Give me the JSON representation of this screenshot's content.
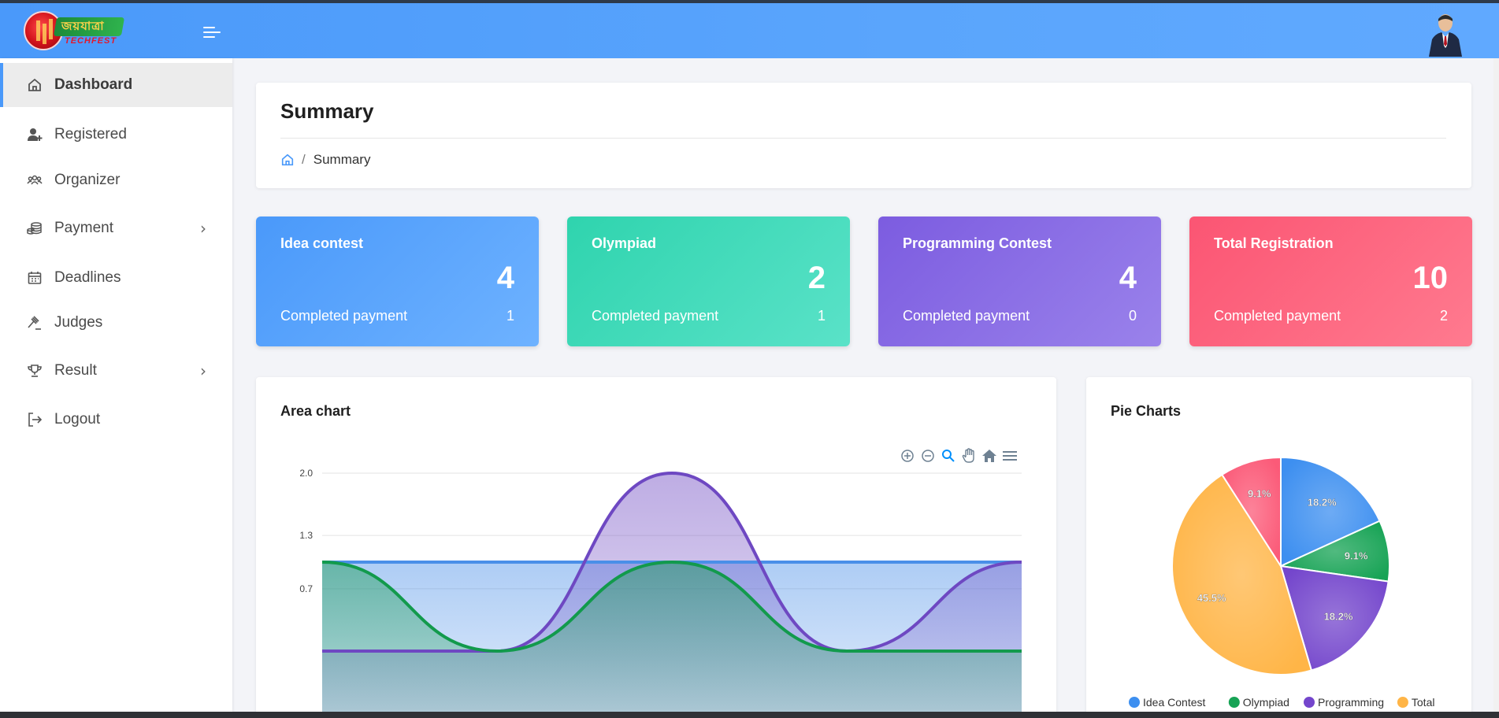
{
  "brand": {
    "logo_text": "জয়যাত্রা",
    "logo_subtext": "TECHFEST"
  },
  "sidebar": {
    "items": [
      {
        "label": "Dashboard",
        "icon": "home-icon",
        "active": true
      },
      {
        "label": "Registered",
        "icon": "user-plus-icon"
      },
      {
        "label": "Organizer",
        "icon": "users-icon"
      },
      {
        "label": "Payment",
        "icon": "coins-icon",
        "has_submenu": true
      },
      {
        "label": "Deadlines",
        "icon": "calendar-icon"
      },
      {
        "label": "Judges",
        "icon": "gavel-icon"
      },
      {
        "label": "Result",
        "icon": "trophy-icon",
        "has_submenu": true
      },
      {
        "label": "Logout",
        "icon": "logout-icon"
      }
    ]
  },
  "page": {
    "title": "Summary",
    "breadcrumb_current": "Summary"
  },
  "stats": [
    {
      "title": "Idea contest",
      "count": "4",
      "payment_label": "Completed payment",
      "payment_value": "1",
      "gradient": [
        "#4a99fa",
        "#6eb2ff"
      ]
    },
    {
      "title": "Olympiad",
      "count": "2",
      "payment_label": "Completed payment",
      "payment_value": "1",
      "gradient": [
        "#2fd4ae",
        "#5ae2c8"
      ]
    },
    {
      "title": "Programming Contest",
      "count": "4",
      "payment_label": "Completed payment",
      "payment_value": "0",
      "gradient": [
        "#7c5ce0",
        "#9a82eb"
      ]
    },
    {
      "title": "Total Registration",
      "count": "10",
      "payment_label": "Completed payment",
      "payment_value": "2",
      "gradient": [
        "#fb5573",
        "#ff7a8f"
      ]
    }
  ],
  "area_card": {
    "title": "Area chart"
  },
  "pie_card": {
    "title": "Pie Charts"
  },
  "chart_data": [
    {
      "type": "area",
      "y_ticks": [
        "2.0",
        "1.3",
        "0.7"
      ],
      "ylim": [
        0,
        2
      ],
      "x": [
        0,
        1,
        2,
        3,
        4
      ],
      "series": [
        {
          "values": [
            1,
            1,
            1,
            1,
            1
          ],
          "color": "#4a8fe8"
        },
        {
          "values": [
            0,
            0,
            2,
            0,
            1
          ],
          "color": "#6e48c2"
        },
        {
          "values": [
            1,
            0,
            1,
            0,
            0
          ],
          "color": "#129a4c"
        }
      ],
      "toolbar": [
        "zoom-in-icon",
        "zoom-out-icon",
        "magnifier-icon",
        "pan-hand-icon",
        "reset-home-icon",
        "menu-icon"
      ]
    },
    {
      "type": "pie",
      "slices": [
        {
          "name": "Idea Contest",
          "value": 18.2,
          "label": "18.2%",
          "color": "#3d8ff0"
        },
        {
          "name": "Olympiad",
          "value": 9.1,
          "label": "9.1%",
          "color": "#17a355"
        },
        {
          "name": "Programming",
          "value": 18.2,
          "label": "18.2%",
          "color": "#7446cc"
        },
        {
          "name": "Total",
          "value": 45.5,
          "label": "45.5%",
          "color": "#ffb547"
        },
        {
          "name": "",
          "value": 9.1,
          "label": "9.1%",
          "color": "#fb5a78"
        }
      ],
      "legend": [
        "Idea Contest",
        "Olympiad",
        "Programming",
        "Total"
      ]
    }
  ]
}
